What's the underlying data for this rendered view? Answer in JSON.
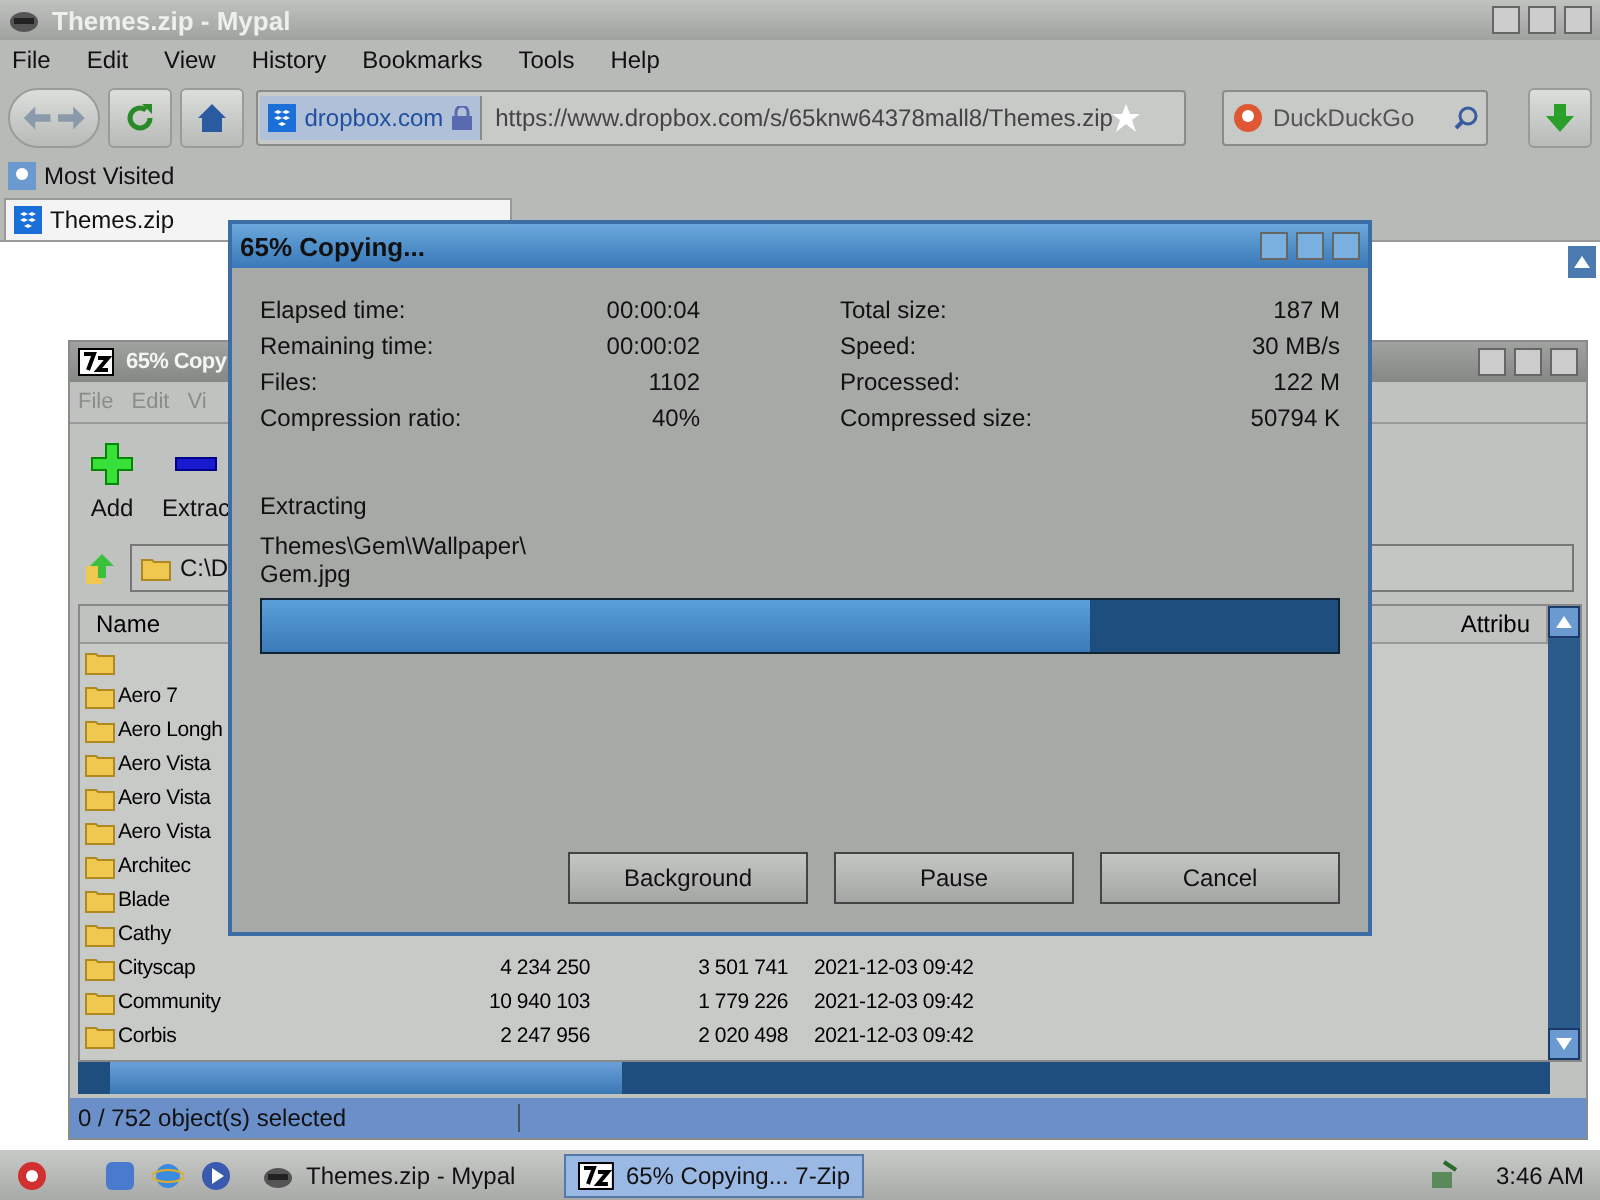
{
  "browser": {
    "title": "Themes.zip - Mypal",
    "menu": [
      "File",
      "Edit",
      "View",
      "History",
      "Bookmarks",
      "Tools",
      "Help"
    ],
    "site_label": "dropbox.com",
    "url": "https://www.dropbox.com/s/65knw64378mall8/Themes.zip",
    "search_placeholder": "DuckDuckGo",
    "bookmarks": [
      "Most Visited"
    ],
    "tabs": [
      {
        "label": "Themes.zip",
        "selected": true
      }
    ]
  },
  "archiver": {
    "title": "65% Copy",
    "menu": [
      {
        "label": "File",
        "disabled": true
      },
      {
        "label": "Edit",
        "disabled": true
      },
      {
        "label": "Vi",
        "disabled": true
      }
    ],
    "tools": [
      {
        "label": "Add",
        "kind": "add"
      },
      {
        "label": "Extrac",
        "kind": "extract"
      }
    ],
    "path": "C:\\D",
    "columns": [
      "Name",
      "Attribu"
    ],
    "rows": [
      {
        "name": ""
      },
      {
        "name": "Aero 7"
      },
      {
        "name": "Aero Longh"
      },
      {
        "name": "Aero Vista"
      },
      {
        "name": "Aero Vista"
      },
      {
        "name": "Aero Vista"
      },
      {
        "name": "Architec"
      },
      {
        "name": "Blade"
      },
      {
        "name": "Cathy"
      },
      {
        "name": "Cityscap",
        "size": "4 234 250",
        "packed": "3 501 741",
        "modified": "2021-12-03 09:42"
      },
      {
        "name": "Community",
        "size": "10 940 103",
        "packed": "1 779 226",
        "modified": "2021-12-03 09:42"
      },
      {
        "name": "Corbis",
        "size": "2 247 956",
        "packed": "2 020 498",
        "modified": "2021-12-03 09:42"
      }
    ],
    "status": "0 / 752 object(s) selected"
  },
  "dialog": {
    "title": "65% Copying...",
    "left_stats": [
      {
        "label": "Elapsed time:",
        "value": "00:00:04"
      },
      {
        "label": "Remaining time:",
        "value": "00:00:02"
      },
      {
        "label": "Files:",
        "value": "1102"
      },
      {
        "label": "Compression ratio:",
        "value": "40%"
      }
    ],
    "right_stats": [
      {
        "label": "Total size:",
        "value": "187 M"
      },
      {
        "label": "Speed:",
        "value": "30 MB/s"
      },
      {
        "label": "Processed:",
        "value": "122 M"
      },
      {
        "label": "Compressed size:",
        "value": "50794 K"
      }
    ],
    "action": "Extracting",
    "path_lines": [
      "Themes\\Gem\\Wallpaper\\",
      "Gem.jpg"
    ],
    "progress": {
      "level": 0.77
    },
    "buttons": [
      "Background",
      "Pause",
      "Cancel"
    ]
  },
  "taskbar": {
    "tasks": [
      {
        "label": "Themes.zip - Mypal",
        "kind": "browser",
        "selected": false
      },
      {
        "label": "65% Copying... 7-Zip",
        "kind": "archiver",
        "selected": true
      }
    ],
    "clock": "3:46 AM"
  }
}
